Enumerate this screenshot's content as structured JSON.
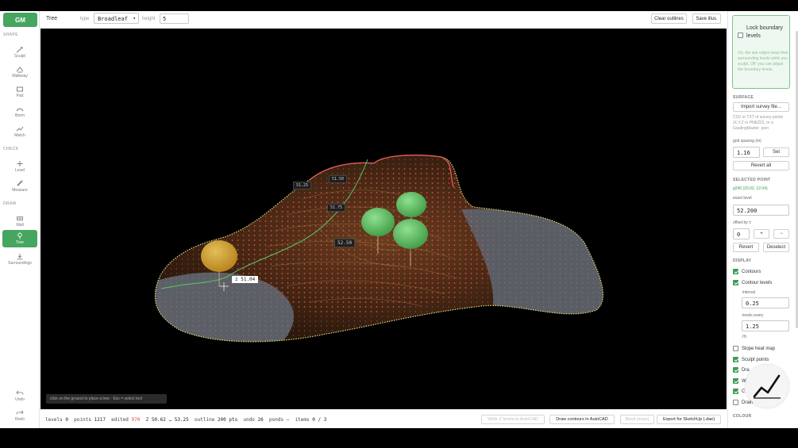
{
  "app": {
    "logo": "GM"
  },
  "leftbar": {
    "sections": {
      "shape": "SHAPE",
      "check": "CHECK",
      "draw": "DRAW"
    },
    "tools": {
      "sculpt": "Sculpt",
      "walkway": "Walkway",
      "pad": "Pad",
      "berm": "Berm",
      "match": "Match",
      "level": "Level",
      "measure": "Measure",
      "wall": "Wall",
      "tree": "Tree",
      "surroundings": "Surroundings",
      "undo": "Undo",
      "redo": "Redo"
    },
    "active_tool": "tree"
  },
  "topbar": {
    "tool_name": "Tree",
    "type_label": "type",
    "type_value": "Broadleaf",
    "height_label": "height",
    "height_value": "5",
    "clear_outlines": "Clear outlines",
    "save_illus": "Save illus."
  },
  "viewport": {
    "hint": "click on the ground to place a tree · Esc = select tool",
    "z_readout": "z 51.04",
    "labels": [
      "51.25",
      "51.50",
      "51.75",
      "52.50"
    ]
  },
  "statusbar": {
    "levels_label": "levels",
    "levels_value": "0",
    "points_label": "points",
    "points_value": "1217",
    "edited_label": "edited",
    "edited_value": "970",
    "z_label": "Z",
    "z_value": "50.62 … 53.25",
    "outline_label": "outline",
    "outline_value": "200 pts",
    "undo_label": "undo",
    "undo_value": "26",
    "ponds_label": "ponds",
    "ponds_value": "–",
    "items_label": "items",
    "items_value": "0 / 3",
    "write_levels": "Write Z levels to AutoCAD",
    "draw_contours": "Draw contours in AutoCAD",
    "revit": "Revit (soon)",
    "export_sketchup": "Export for SketchUp (.dae)"
  },
  "rightpanel": {
    "lock_title": "Lock boundary levels",
    "lock_desc": "On: the site edges keep their surrounding levels while you sculpt. Off: you can adjust the boundary levels.",
    "surface_heading": "SURFACE",
    "import_button": "Import survey file...",
    "import_desc": "CSV or TXT of survey points (X,Y,Z or PNEZD), or a GradingMaster .json",
    "grid_label": "grid spacing (m)",
    "grid_value": "1.16",
    "set_button": "Set",
    "revert_all": "Revert all",
    "selected_heading": "SELECTED POINT",
    "selected_point": "g240 (20.02, 12.04)",
    "exact_label": "exact level",
    "exact_value": "52.200",
    "offset_label": "offset by ±",
    "offset_value": "0",
    "plus": "+",
    "minus": "−",
    "revert": "Revert",
    "deselect": "Deselect",
    "display_heading": "DISPLAY",
    "contours": "Contours",
    "contour_levels": "Contour levels",
    "interval_label": "interval",
    "interval_value": "0.25",
    "levels_every_label": "levels every",
    "levels_every_value": "1.25",
    "unit_m": "m",
    "slope_heat_map": "Slope heat map",
    "sculpt_points": "Sculpt points",
    "dra_partial": "Dra",
    "w_partial": "W",
    "c_partial": "C",
    "drain_partial": "Drain",
    "colour_heading": "COLOUR",
    "brand_color": "#46a65f"
  }
}
